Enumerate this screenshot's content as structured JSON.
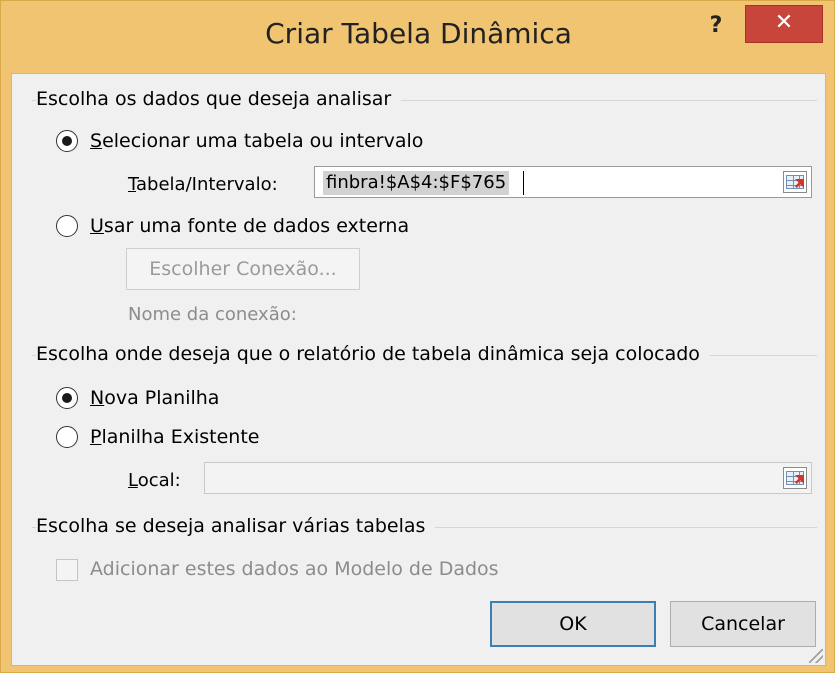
{
  "dialog": {
    "title": "Criar Tabela Dinâmica",
    "help_glyph": "?",
    "close_glyph": "✕"
  },
  "section_data": {
    "heading": "Escolha os dados que deseja analisar",
    "option_table": {
      "label": "Selecionar uma tabela ou intervalo",
      "checked": true
    },
    "range_label": "Tabela/Intervalo:",
    "range_value": "finbra!$A$4:$F$765",
    "option_external": {
      "label": "Usar uma fonte de dados externa",
      "checked": false
    },
    "choose_connection_label": "Escolher Conexão...",
    "connection_name_label": "Nome da conexão:"
  },
  "section_location": {
    "heading": "Escolha onde deseja que o relatório de tabela dinâmica seja colocado",
    "option_new_sheet": {
      "label": "Nova Planilha",
      "checked": true
    },
    "option_existing_sheet": {
      "label": "Planilha Existente",
      "checked": false
    },
    "location_label": "Local:",
    "location_value": ""
  },
  "section_multi": {
    "heading": "Escolha se deseja analisar várias tabelas",
    "add_to_model_label": "Adicionar estes dados ao Modelo de Dados",
    "add_to_model_checked": false
  },
  "buttons": {
    "ok": "OK",
    "cancel": "Cancelar"
  }
}
